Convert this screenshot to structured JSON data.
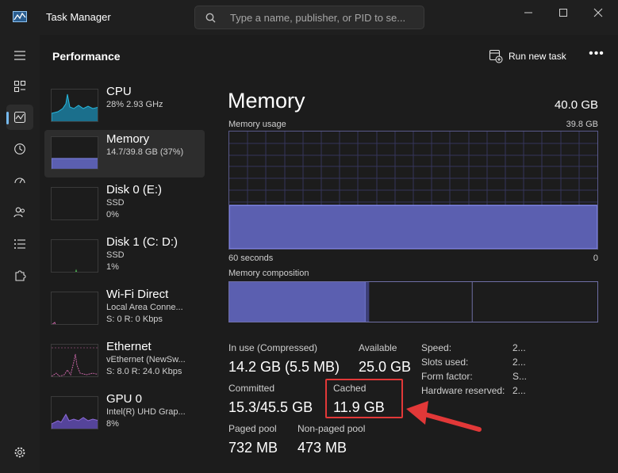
{
  "window": {
    "title": "Task Manager",
    "search_placeholder": "Type a name, publisher, or PID to se..."
  },
  "header": {
    "title": "Performance",
    "run_new_task": "Run new task",
    "more": "•••"
  },
  "devices": [
    {
      "name": "CPU",
      "line1": "28%  2.93 GHz",
      "line2": "",
      "color": "#17a2c8"
    },
    {
      "name": "Memory",
      "line1": "14.7/39.8 GB (37%)",
      "line2": "",
      "color": "#6b6fd9"
    },
    {
      "name": "Disk 0 (E:)",
      "line1": "SSD",
      "line2": "0%",
      "color": "#4caf50"
    },
    {
      "name": "Disk 1 (C: D:)",
      "line1": "SSD",
      "line2": "1%",
      "color": "#4caf50"
    },
    {
      "name": "Wi-Fi Direct",
      "line1": "Local Area Conne...",
      "line2": "S: 0  R: 0 Kbps",
      "color": "#c765a6"
    },
    {
      "name": "Ethernet",
      "line1": "vEthernet (NewSw...",
      "line2": "S: 8.0  R: 24.0 Kbps",
      "color": "#c765a6"
    },
    {
      "name": "GPU 0",
      "line1": "Intel(R) UHD Grap...",
      "line2": "8%",
      "color": "#8e6bd9"
    }
  ],
  "memory": {
    "title": "Memory",
    "total": "40.0 GB",
    "usage_label": "Memory usage",
    "usage_max": "39.8 GB",
    "axis_left": "60 seconds",
    "axis_right": "0",
    "usage_fraction": 0.37,
    "composition_label": "Memory composition",
    "composition_in_use_fraction": 0.37,
    "composition_modified_fraction": 0.01,
    "composition_standby_fraction": 0.28,
    "stats": {
      "in_use_label": "In use (Compressed)",
      "in_use_value": "14.2 GB (5.5 MB)",
      "available_label": "Available",
      "available_value": "25.0 GB",
      "committed_label": "Committed",
      "committed_value": "15.3/45.5 GB",
      "cached_label": "Cached",
      "cached_value": "11.9 GB",
      "paged_label": "Paged pool",
      "paged_value": "732 MB",
      "nonpaged_label": "Non-paged pool",
      "nonpaged_value": "473 MB"
    },
    "details": [
      {
        "label": "Speed:",
        "value": "2..."
      },
      {
        "label": "Slots used:",
        "value": "2..."
      },
      {
        "label": "Form factor:",
        "value": "S..."
      },
      {
        "label": "Hardware reserved:",
        "value": "2..."
      }
    ]
  },
  "colors": {
    "memory_fill": "#5b5fb0",
    "memory_line": "#7f84e6",
    "highlight": "#e23838",
    "accent": "#76b9ed"
  }
}
